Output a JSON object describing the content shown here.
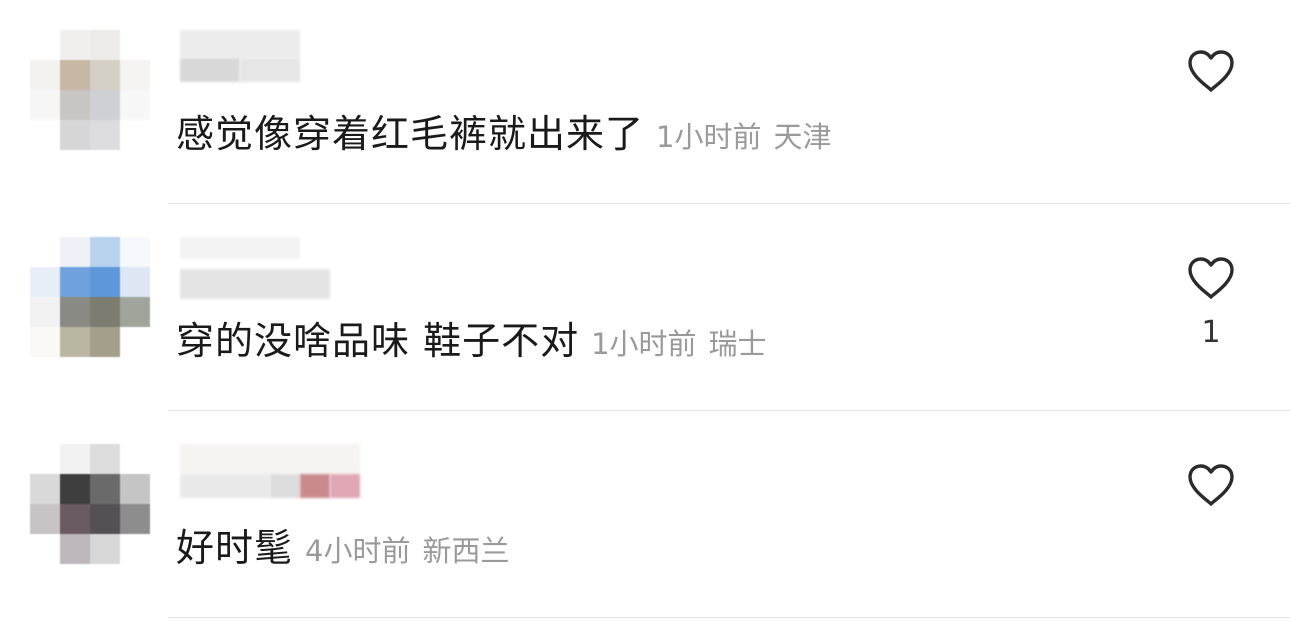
{
  "comments": [
    {
      "text": "感觉像穿着红毛裤就出来了",
      "time": "1小时前",
      "location": "天津",
      "like_count": "",
      "like_icon": "heart-outline-icon",
      "avatar_colors": [
        "#ffffff",
        "#f0efee",
        "#ecebea",
        "#ffffff",
        "#f3f2f1",
        "#c7b7a5",
        "#d4d0c6",
        "#f5f4f2",
        "#f6f6f6",
        "#c9c5c3",
        "#cfd0d5",
        "#f7f7f7",
        "#ffffff",
        "#d6d6d6",
        "#dcdce0",
        "#ffffff"
      ]
    },
    {
      "text": "穿的没啥品味 鞋子不对",
      "time": "1小时前",
      "location": "瑞士",
      "like_count": "1",
      "like_icon": "heart-outline-icon",
      "avatar_colors": [
        "#ffffff",
        "#eef2f8",
        "#b8d2ee",
        "#f5f8fc",
        "#e8eef7",
        "#6fa2dd",
        "#5e97da",
        "#dce7f3",
        "#f2f2f2",
        "#8a8a84",
        "#7d7c70",
        "#9fa59b",
        "#fbf8f8",
        "#b9b6a2",
        "#a39f8a",
        "#ffffff"
      ]
    },
    {
      "text": "好时髦",
      "time": "4小时前",
      "location": "新西兰",
      "like_count": "",
      "like_icon": "heart-outline-icon",
      "avatar_colors": [
        "#ffffff",
        "#f2f2f2",
        "#dcdcdc",
        "#ffffff",
        "#d9d9d9",
        "#3e3e3e",
        "#6a6a6a",
        "#c5c5c5",
        "#c8c4c6",
        "#6a5b62",
        "#555055",
        "#8d8d8d",
        "#ffffff",
        "#bdb7bb",
        "#d7d7d7",
        "#ffffff"
      ]
    }
  ]
}
